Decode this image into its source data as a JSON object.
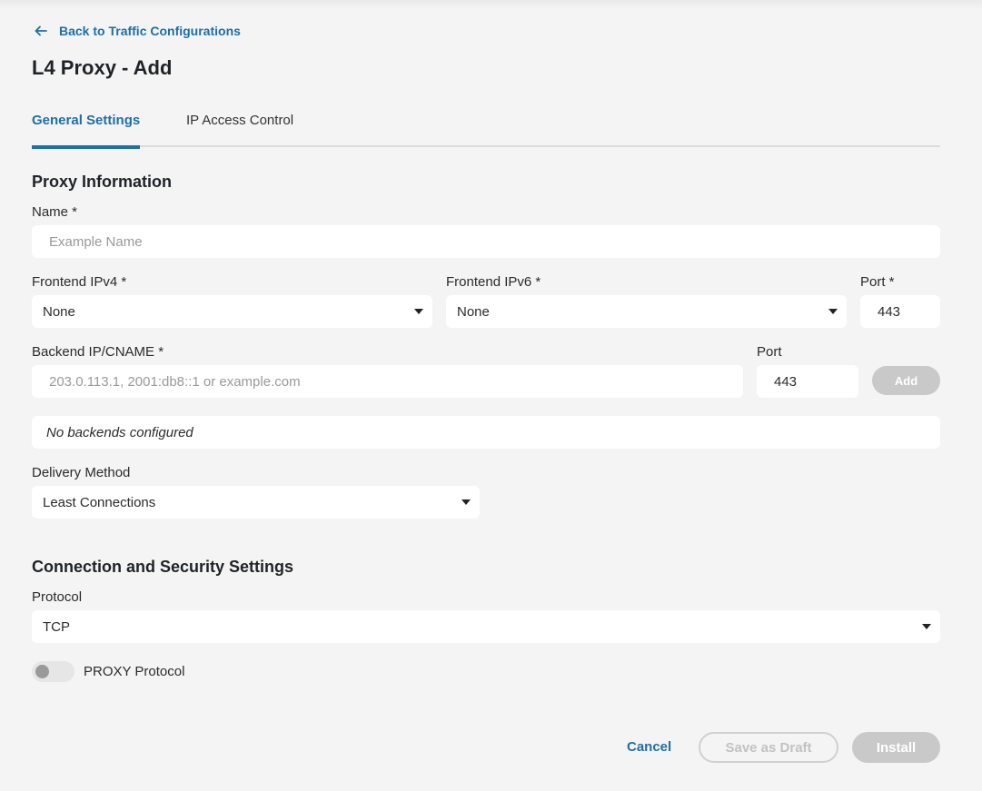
{
  "header": {
    "back_link": "Back to Traffic Configurations",
    "title": "L4 Proxy - Add"
  },
  "tabs": [
    {
      "label": "General Settings",
      "active": true
    },
    {
      "label": "IP Access Control",
      "active": false
    }
  ],
  "proxy_information": {
    "section_title": "Proxy Information",
    "name": {
      "label": "Name *",
      "placeholder": "Example Name",
      "value": ""
    },
    "frontend_ipv4": {
      "label": "Frontend IPv4 *",
      "value": "None"
    },
    "frontend_ipv6": {
      "label": "Frontend IPv6 *",
      "value": "None"
    },
    "frontend_port": {
      "label": "Port *",
      "value": "443"
    },
    "backend": {
      "label": "Backend IP/CNAME *",
      "placeholder": "203.0.113.1, 2001:db8::1 or example.com",
      "value": ""
    },
    "backend_port": {
      "label": "Port",
      "value": "443"
    },
    "add_button": "Add",
    "backends_empty": "No backends configured",
    "delivery_method": {
      "label": "Delivery Method",
      "value": "Least Connections"
    }
  },
  "connection_security": {
    "section_title": "Connection and Security Settings",
    "protocol": {
      "label": "Protocol",
      "value": "TCP"
    },
    "proxy_protocol": {
      "label": "PROXY Protocol",
      "enabled": false
    }
  },
  "footer": {
    "cancel": "Cancel",
    "save_draft": "Save as Draft",
    "install": "Install"
  },
  "colors": {
    "accent": "#1e6fa8",
    "disabled": "#c9c9c9",
    "background": "#f4f4f4"
  },
  "icons": {
    "back": "arrow-left-icon",
    "dropdown": "caret-down-icon"
  }
}
